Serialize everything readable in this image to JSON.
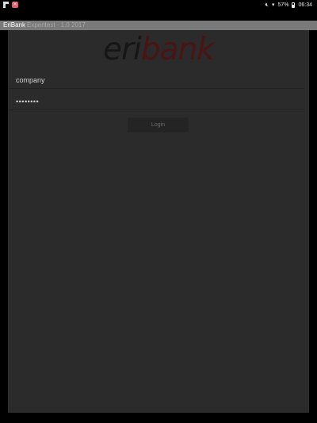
{
  "status_bar": {
    "battery_level": "57%",
    "time": "06:34",
    "icons": [
      "flipboard-icon",
      "notification-icon",
      "mute-icon",
      "wifi-icon",
      "battery-icon"
    ]
  },
  "app": {
    "title": "EriBank",
    "title_ghost": "Experitest · 1.0 2017"
  },
  "logo": {
    "part1": "eri",
    "part2": "bank",
    "colors": {
      "part1": "#161616",
      "part2": "#4a1414"
    }
  },
  "form": {
    "username_value": "company",
    "password_value": "••••••••",
    "login_label": "Login"
  }
}
